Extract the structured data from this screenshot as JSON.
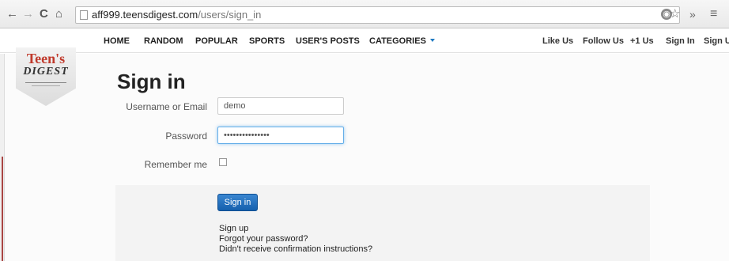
{
  "browser": {
    "back_icon": "←",
    "forward_icon": "→",
    "reload_icon": "C",
    "home_icon": "⌂",
    "url_host": "aff999.teensdigest.com",
    "url_path": "/users/sign_in",
    "star_icon": "☆",
    "menu_icon": "≡",
    "more_icon": "»"
  },
  "site_nav": {
    "left": [
      "HOME",
      "RANDOM",
      "POPULAR",
      "SPORTS",
      "USER'S POSTS",
      "CATEGORIES"
    ],
    "right": [
      "Like Us",
      "Follow Us",
      "+1 Us",
      "Sign In",
      "Sign Up"
    ],
    "accent_color": "#1d79c1"
  },
  "logo": {
    "line1": "Teen's",
    "line2": "DIGEST"
  },
  "form": {
    "title": "Sign in",
    "username_label": "Username or Email",
    "username_value": "demo",
    "password_label": "Password",
    "password_value": "•••••••••••••••",
    "remember_label": "Remember me",
    "submit_label": "Sign in"
  },
  "links": [
    "Sign up",
    "Forgot your password?",
    "Didn't receive confirmation instructions?"
  ]
}
